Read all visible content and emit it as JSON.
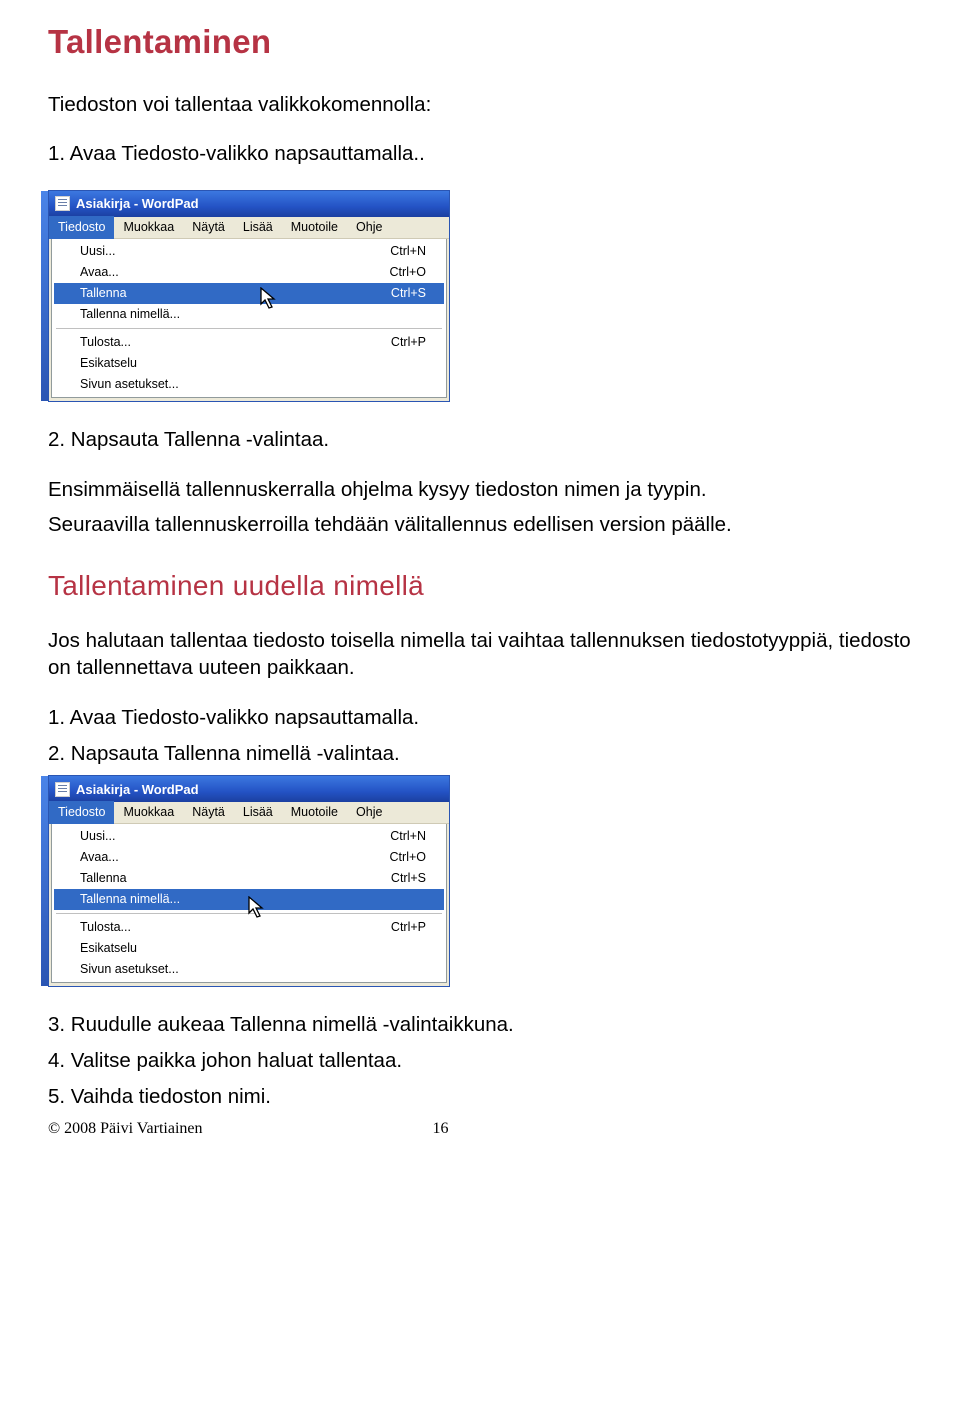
{
  "heading1": "Tallentaminen",
  "intro": "Tiedoston voi tallentaa valikkokomennolla:",
  "step1_1": "1. Avaa Tiedosto-valikko napsauttamalla..",
  "window1": {
    "title": "Asiakirja - WordPad",
    "menubar": [
      "Tiedosto",
      "Muokkaa",
      "Näytä",
      "Lisää",
      "Muotoile",
      "Ohje"
    ],
    "items": [
      {
        "label": "Uusi...",
        "short": "Ctrl+N"
      },
      {
        "label": "Avaa...",
        "short": "Ctrl+O"
      },
      {
        "label": "Tallenna",
        "short": "Ctrl+S",
        "hl": true
      },
      {
        "label": "Tallenna nimellä...",
        "short": ""
      },
      {
        "sep": true
      },
      {
        "label": "Tulosta...",
        "short": "Ctrl+P"
      },
      {
        "label": "Esikatselu",
        "short": ""
      },
      {
        "label": "Sivun asetukset...",
        "short": ""
      }
    ]
  },
  "step1_2": "2. Napsauta Tallenna -valintaa.",
  "para1a": "Ensimmäisellä tallennuskerralla ohjelma kysyy tiedoston nimen ja tyypin.",
  "para1b": "Seuraavilla tallennuskerroilla tehdään välitallennus edellisen version päälle.",
  "heading2": "Tallentaminen uudella nimellä",
  "para2": "Jos halutaan tallentaa tiedosto toisella nimella tai vaihtaa  tallennuksen tiedostotyyppiä, tiedosto on tallennettava uuteen paikkaan.",
  "step2_1": "1. Avaa Tiedosto-valikko napsauttamalla.",
  "step2_2": "2. Napsauta Tallenna nimellä -valintaa.",
  "window2": {
    "title": "Asiakirja - WordPad",
    "menubar": [
      "Tiedosto",
      "Muokkaa",
      "Näytä",
      "Lisää",
      "Muotoile",
      "Ohje"
    ],
    "items": [
      {
        "label": "Uusi...",
        "short": "Ctrl+N"
      },
      {
        "label": "Avaa...",
        "short": "Ctrl+O"
      },
      {
        "label": "Tallenna",
        "short": "Ctrl+S"
      },
      {
        "label": "Tallenna nimellä...",
        "short": "",
        "hl": true
      },
      {
        "sep": true
      },
      {
        "label": "Tulosta...",
        "short": "Ctrl+P"
      },
      {
        "label": "Esikatselu",
        "short": ""
      },
      {
        "label": "Sivun asetukset...",
        "short": ""
      }
    ]
  },
  "step2_3": "3. Ruudulle aukeaa Tallenna nimellä -valintaikkuna.",
  "step2_4": "4. Valitse paikka johon haluat tallentaa.",
  "step2_5": "5. Vaihda tiedoston nimi.",
  "footer": {
    "copy": "© 2008 Päivi Vartiainen",
    "page": "16"
  }
}
